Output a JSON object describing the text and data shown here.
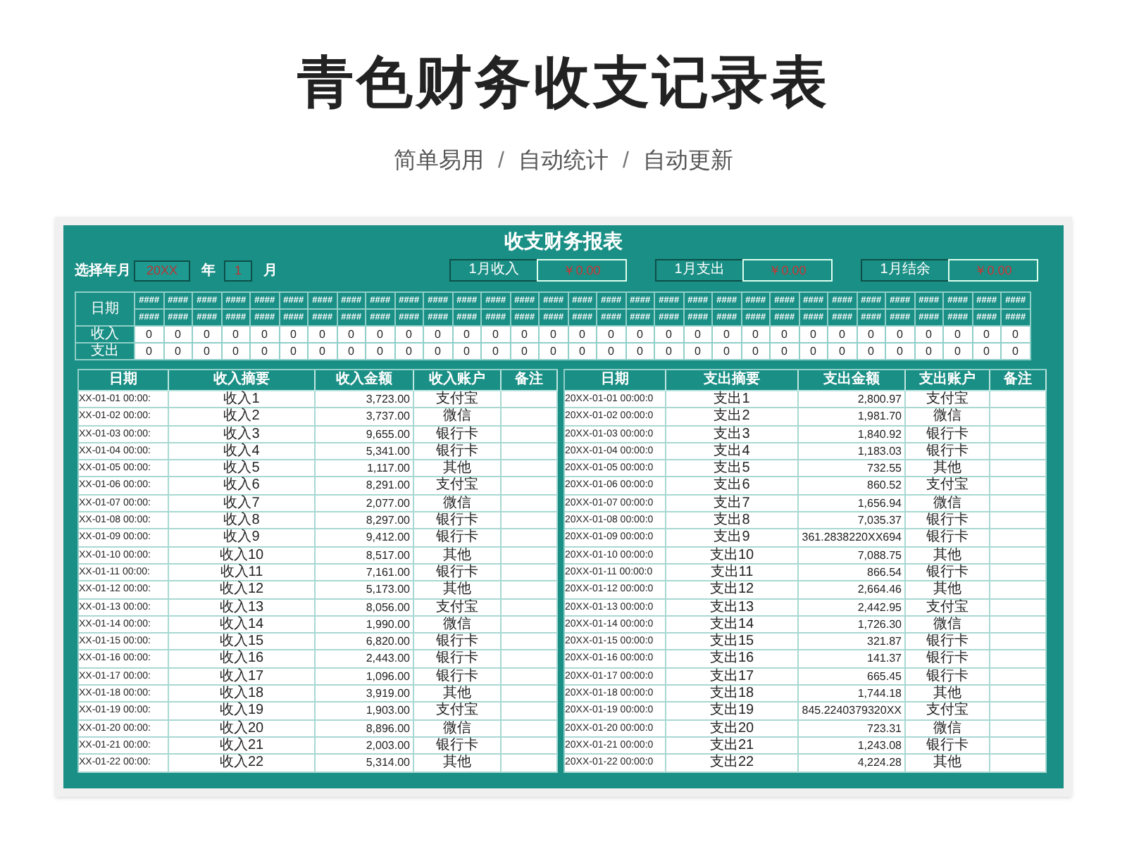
{
  "title": "青色财务收支记录表",
  "subtitle": [
    {
      "text": "简单易用"
    },
    {
      "text": "/",
      "kind": "separator"
    },
    {
      "text": "自动统计"
    },
    {
      "text": "/",
      "kind": "separator"
    },
    {
      "text": "自动更新"
    }
  ],
  "sheet": {
    "title": "收支财务报表",
    "year_label": "选择年月",
    "year_value": "20XX",
    "year_unit": "年",
    "month_value": "1",
    "month_unit": "月",
    "summaries": [
      {
        "label": "1月收入",
        "value": "￥0.00"
      },
      {
        "label": "1月支出",
        "value": "￥0.00"
      },
      {
        "label": "1月结余",
        "value": "￥0.00"
      }
    ],
    "calendar": {
      "date_label": "日期",
      "income_label": "收入",
      "expense_label": "支出",
      "days": [
        {
          "top": "####",
          "bottom": "####",
          "income": "0",
          "expense": "0"
        },
        {
          "top": "####",
          "bottom": "####",
          "income": "0",
          "expense": "0"
        },
        {
          "top": "####",
          "bottom": "####",
          "income": "0",
          "expense": "0"
        },
        {
          "top": "####",
          "bottom": "####",
          "income": "0",
          "expense": "0"
        },
        {
          "top": "####",
          "bottom": "####",
          "income": "0",
          "expense": "0"
        },
        {
          "top": "####",
          "bottom": "####",
          "income": "0",
          "expense": "0"
        },
        {
          "top": "####",
          "bottom": "####",
          "income": "0",
          "expense": "0"
        },
        {
          "top": "####",
          "bottom": "####",
          "income": "0",
          "expense": "0"
        },
        {
          "top": "####",
          "bottom": "####",
          "income": "0",
          "expense": "0"
        },
        {
          "top": "####",
          "bottom": "####",
          "income": "0",
          "expense": "0"
        },
        {
          "top": "####",
          "bottom": "####",
          "income": "0",
          "expense": "0"
        },
        {
          "top": "####",
          "bottom": "####",
          "income": "0",
          "expense": "0"
        },
        {
          "top": "####",
          "bottom": "####",
          "income": "0",
          "expense": "0"
        },
        {
          "top": "####",
          "bottom": "####",
          "income": "0",
          "expense": "0"
        },
        {
          "top": "####",
          "bottom": "####",
          "income": "0",
          "expense": "0"
        },
        {
          "top": "####",
          "bottom": "####",
          "income": "0",
          "expense": "0"
        },
        {
          "top": "####",
          "bottom": "####",
          "income": "0",
          "expense": "0"
        },
        {
          "top": "####",
          "bottom": "####",
          "income": "0",
          "expense": "0"
        },
        {
          "top": "####",
          "bottom": "####",
          "income": "0",
          "expense": "0"
        },
        {
          "top": "####",
          "bottom": "####",
          "income": "0",
          "expense": "0"
        },
        {
          "top": "####",
          "bottom": "####",
          "income": "0",
          "expense": "0"
        },
        {
          "top": "####",
          "bottom": "####",
          "income": "0",
          "expense": "0"
        },
        {
          "top": "####",
          "bottom": "####",
          "income": "0",
          "expense": "0"
        },
        {
          "top": "####",
          "bottom": "####",
          "income": "0",
          "expense": "0"
        },
        {
          "top": "####",
          "bottom": "####",
          "income": "0",
          "expense": "0"
        },
        {
          "top": "####",
          "bottom": "####",
          "income": "0",
          "expense": "0"
        },
        {
          "top": "####",
          "bottom": "####",
          "income": "0",
          "expense": "0"
        },
        {
          "top": "####",
          "bottom": "####",
          "income": "0",
          "expense": "0"
        },
        {
          "top": "####",
          "bottom": "####",
          "income": "0",
          "expense": "0"
        },
        {
          "top": "####",
          "bottom": "####",
          "income": "0",
          "expense": "0"
        },
        {
          "top": "####",
          "bottom": "####",
          "income": "0",
          "expense": "0"
        }
      ]
    },
    "tables": [
      {
        "columns": [
          "日期",
          "收入摘要",
          "收入金额",
          "收入账户",
          "备注"
        ],
        "rows": [
          [
            "XX-01-01 00:00:",
            "收入1",
            "3,723.00",
            "支付宝"
          ],
          [
            "XX-01-02 00:00:",
            "收入2",
            "3,737.00",
            "微信"
          ],
          [
            "XX-01-03 00:00:",
            "收入3",
            "9,655.00",
            "银行卡"
          ],
          [
            "XX-01-04 00:00:",
            "收入4",
            "5,341.00",
            "银行卡"
          ],
          [
            "XX-01-05 00:00:",
            "收入5",
            "1,117.00",
            "其他"
          ],
          [
            "XX-01-06 00:00:",
            "收入6",
            "8,291.00",
            "支付宝"
          ],
          [
            "XX-01-07 00:00:",
            "收入7",
            "2,077.00",
            "微信"
          ],
          [
            "XX-01-08 00:00:",
            "收入8",
            "8,297.00",
            "银行卡"
          ],
          [
            "XX-01-09 00:00:",
            "收入9",
            "9,412.00",
            "银行卡"
          ],
          [
            "XX-01-10 00:00:",
            "收入10",
            "8,517.00",
            "其他"
          ],
          [
            "XX-01-11 00:00:",
            "收入11",
            "7,161.00",
            "银行卡"
          ],
          [
            "XX-01-12 00:00:",
            "收入12",
            "5,173.00",
            "其他"
          ],
          [
            "XX-01-13 00:00:",
            "收入13",
            "8,056.00",
            "支付宝"
          ],
          [
            "XX-01-14 00:00:",
            "收入14",
            "1,990.00",
            "微信"
          ],
          [
            "XX-01-15 00:00:",
            "收入15",
            "6,820.00",
            "银行卡"
          ],
          [
            "XX-01-16 00:00:",
            "收入16",
            "2,443.00",
            "银行卡"
          ],
          [
            "XX-01-17 00:00:",
            "收入17",
            "1,096.00",
            "银行卡"
          ],
          [
            "XX-01-18 00:00:",
            "收入18",
            "3,919.00",
            "其他"
          ],
          [
            "XX-01-19 00:00:",
            "收入19",
            "1,903.00",
            "支付宝"
          ],
          [
            "XX-01-20 00:00:",
            "收入20",
            "8,896.00",
            "微信"
          ],
          [
            "XX-01-21 00:00:",
            "收入21",
            "2,003.00",
            "银行卡"
          ],
          [
            "XX-01-22 00:00:",
            "收入22",
            "5,314.00",
            "其他"
          ]
        ]
      },
      {
        "columns": [
          "日期",
          "支出摘要",
          "支出金额",
          "支出账户",
          "备注"
        ],
        "rows": [
          [
            "20XX-01-01 00:00:0",
            "支出1",
            "2,800.97",
            "支付宝"
          ],
          [
            "20XX-01-02 00:00:0",
            "支出2",
            "1,981.70",
            "微信"
          ],
          [
            "20XX-01-03 00:00:0",
            "支出3",
            "1,840.92",
            "银行卡"
          ],
          [
            "20XX-01-04 00:00:0",
            "支出4",
            "1,183.03",
            "银行卡"
          ],
          [
            "20XX-01-05 00:00:0",
            "支出5",
            "732.55",
            "其他"
          ],
          [
            "20XX-01-06 00:00:0",
            "支出6",
            "860.52",
            "支付宝"
          ],
          [
            "20XX-01-07 00:00:0",
            "支出7",
            "1,656.94",
            "微信"
          ],
          [
            "20XX-01-08 00:00:0",
            "支出8",
            "7,035.37",
            "银行卡"
          ],
          [
            "20XX-01-09 00:00:0",
            "支出9",
            "361.2838220XX694",
            "银行卡"
          ],
          [
            "20XX-01-10 00:00:0",
            "支出10",
            "7,088.75",
            "其他"
          ],
          [
            "20XX-01-11 00:00:0",
            "支出11",
            "866.54",
            "银行卡"
          ],
          [
            "20XX-01-12 00:00:0",
            "支出12",
            "2,664.46",
            "其他"
          ],
          [
            "20XX-01-13 00:00:0",
            "支出13",
            "2,442.95",
            "支付宝"
          ],
          [
            "20XX-01-14 00:00:0",
            "支出14",
            "1,726.30",
            "微信"
          ],
          [
            "20XX-01-15 00:00:0",
            "支出15",
            "321.87",
            "银行卡"
          ],
          [
            "20XX-01-16 00:00:0",
            "支出16",
            "141.37",
            "银行卡"
          ],
          [
            "20XX-01-17 00:00:0",
            "支出17",
            "665.45",
            "银行卡"
          ],
          [
            "20XX-01-18 00:00:0",
            "支出18",
            "1,744.18",
            "其他"
          ],
          [
            "20XX-01-19 00:00:0",
            "支出19",
            "845.2240379320XX",
            "支付宝"
          ],
          [
            "20XX-01-20 00:00:0",
            "支出20",
            "723.31",
            "微信"
          ],
          [
            "20XX-01-21 00:00:0",
            "支出21",
            "1,243.08",
            "银行卡"
          ],
          [
            "20XX-01-22 00:00:0",
            "支出22",
            "4,224.28",
            "其他"
          ]
        ]
      }
    ]
  }
}
